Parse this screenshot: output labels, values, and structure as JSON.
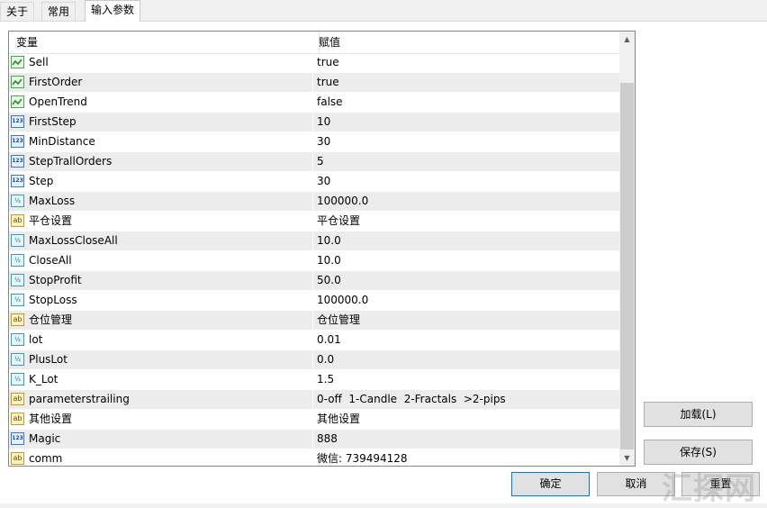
{
  "tabs": [
    "关于",
    "常用",
    "输入参数"
  ],
  "grid": {
    "headers": {
      "variable": "变量",
      "value": "赋值"
    },
    "rows": [
      {
        "icon": "bool-icon",
        "name": "Sell",
        "value": "true"
      },
      {
        "icon": "bool-icon",
        "name": "FirstOrder",
        "value": "true"
      },
      {
        "icon": "bool-icon",
        "name": "OpenTrend",
        "value": "false"
      },
      {
        "icon": "int-icon",
        "name": "FirstStep",
        "value": "10"
      },
      {
        "icon": "int-icon",
        "name": "MinDistance",
        "value": "30"
      },
      {
        "icon": "int-icon",
        "name": "StepTrallOrders",
        "value": "5"
      },
      {
        "icon": "int-icon",
        "name": "Step",
        "value": "30"
      },
      {
        "icon": "double-icon",
        "name": "MaxLoss",
        "value": "100000.0"
      },
      {
        "icon": "string-icon",
        "name": "平仓设置",
        "value": "平仓设置"
      },
      {
        "icon": "double-icon",
        "name": "MaxLossCloseAll",
        "value": "10.0"
      },
      {
        "icon": "double-icon",
        "name": "CloseAll",
        "value": "10.0"
      },
      {
        "icon": "double-icon",
        "name": "StopProfit",
        "value": "50.0"
      },
      {
        "icon": "double-icon",
        "name": "StopLoss",
        "value": "100000.0"
      },
      {
        "icon": "string-icon",
        "name": "仓位管理",
        "value": "仓位管理"
      },
      {
        "icon": "double-icon",
        "name": "lot",
        "value": "0.01"
      },
      {
        "icon": "double-icon",
        "name": "PlusLot",
        "value": "0.0"
      },
      {
        "icon": "double-icon",
        "name": "K_Lot",
        "value": "1.5"
      },
      {
        "icon": "string-icon",
        "name": "parameterstrailing",
        "value": "0-off  1-Candle  2-Fractals  >2-pips"
      },
      {
        "icon": "string-icon",
        "name": "其他设置",
        "value": "其他设置"
      },
      {
        "icon": "int-icon",
        "name": "Magic",
        "value": "888"
      },
      {
        "icon": "string-icon",
        "name": "comm",
        "value": "微信: 739494128"
      }
    ]
  },
  "icon_glyphs": {
    "int": "123",
    "double": "½",
    "string": "ab"
  },
  "buttons": {
    "load": "加载(L)",
    "save": "保存(S)",
    "ok": "确定",
    "cancel": "取消",
    "reset": "重置"
  },
  "watermark": "汇探网"
}
